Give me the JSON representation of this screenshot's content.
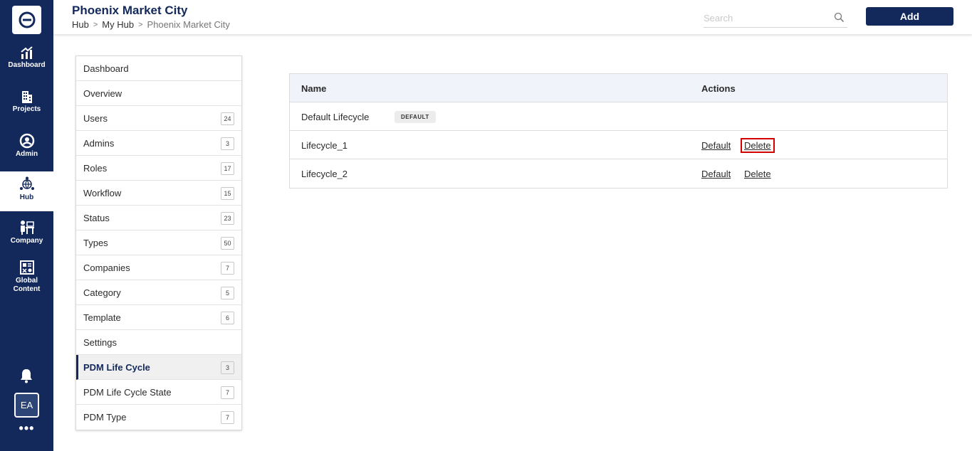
{
  "rail": {
    "items": [
      {
        "label": "Dashboard",
        "icon": "chart-growth-icon"
      },
      {
        "label": "Projects",
        "icon": "building-icon"
      },
      {
        "label": "Admin",
        "icon": "admin-gear-icon"
      },
      {
        "label": "Hub",
        "icon": "hub-globe-icon"
      },
      {
        "label": "Company",
        "icon": "company-desk-icon"
      },
      {
        "label": "Global Content",
        "icon": "global-content-icon"
      }
    ],
    "active": "Hub",
    "avatar": "EA",
    "more": "•••"
  },
  "header": {
    "title": "Phoenix Market City",
    "breadcrumb": [
      "Hub",
      "My Hub",
      "Phoenix Market City"
    ],
    "search_placeholder": "Search",
    "add_label": "Add"
  },
  "menu": {
    "items": [
      {
        "label": "Dashboard",
        "count": ""
      },
      {
        "label": "Overview",
        "count": ""
      },
      {
        "label": "Users",
        "count": "24"
      },
      {
        "label": "Admins",
        "count": "3"
      },
      {
        "label": "Roles",
        "count": "17"
      },
      {
        "label": "Workflow",
        "count": "15"
      },
      {
        "label": "Status",
        "count": "23"
      },
      {
        "label": "Types",
        "count": "50"
      },
      {
        "label": "Companies",
        "count": "7"
      },
      {
        "label": "Category",
        "count": "5"
      },
      {
        "label": "Template",
        "count": "6"
      },
      {
        "label": "Settings",
        "count": ""
      },
      {
        "label": "PDM Life Cycle",
        "count": "3"
      },
      {
        "label": "PDM Life Cycle State",
        "count": "7"
      },
      {
        "label": "PDM Type",
        "count": "7"
      }
    ],
    "active": "PDM Life Cycle"
  },
  "table": {
    "columns": [
      "Name",
      "Actions"
    ],
    "rows": [
      {
        "name": "Default Lifecycle",
        "badge": "DEFAULT",
        "actions": []
      },
      {
        "name": "Lifecycle_1",
        "badge": "",
        "actions": [
          "Default",
          "Delete"
        ]
      },
      {
        "name": "Lifecycle_2",
        "badge": "",
        "actions": [
          "Default",
          "Delete"
        ]
      }
    ]
  },
  "colors": {
    "navy": "#13295b",
    "highlight": "#d40000"
  }
}
